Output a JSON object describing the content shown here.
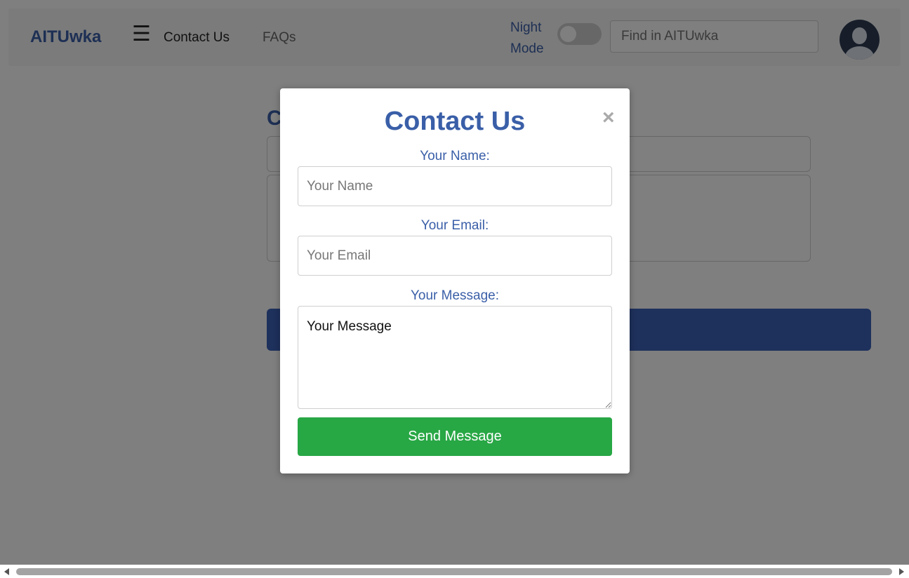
{
  "nav": {
    "brand": "AITUwka",
    "menu_icon": "☰",
    "links": [
      "Contact Us",
      "FAQs"
    ],
    "night_mode_label": "Night Mode",
    "night_mode_on": false,
    "search_placeholder": "Find in AITUwka"
  },
  "background_card": {
    "title_fragment": "C"
  },
  "modal": {
    "title": "Contact Us",
    "close_symbol": "×",
    "name_label": "Your Name:",
    "name_placeholder": "Your Name",
    "email_label": "Your Email:",
    "email_placeholder": "Your Email",
    "message_label": "Your Message:",
    "message_value": "Your Message",
    "send_label": "Send Message"
  },
  "colors": {
    "brand_blue": "#3a5fa8",
    "send_green": "#28a745",
    "primary_button": "#3d62b8"
  },
  "icons": {
    "menu": "hamburger-icon",
    "close": "close-icon",
    "avatar": "user-avatar-icon"
  }
}
